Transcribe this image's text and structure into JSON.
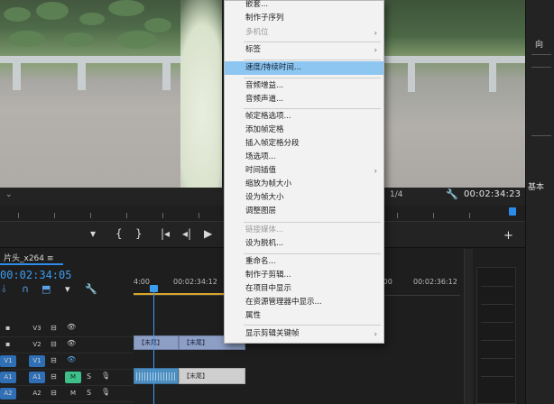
{
  "monitor": {
    "timecode": "00:02:34:23",
    "zoom": "1/4",
    "dropdown_icon": "chevron-down-icon"
  },
  "right_panel": {
    "label_top": "向",
    "label_mid": "基本"
  },
  "timeline": {
    "sequence_name": "片头_x264",
    "sequence_tc": "00:02:34:05",
    "ruler": [
      "4:00",
      "00:02:34:12",
      "00:02:35:00",
      "00:02:36:12"
    ],
    "tracks": [
      {
        "src": "",
        "name": "V3"
      },
      {
        "src": "",
        "name": "V2"
      },
      {
        "src": "V1",
        "name": "V1"
      },
      {
        "src": "A1",
        "name": "A1"
      },
      {
        "src": "A2",
        "name": "A2"
      }
    ],
    "track_buttons": {
      "mute": "M",
      "solo": "S"
    },
    "clips": {
      "v1a": "【末尾】",
      "v1b": "【末尾】",
      "a1b": "【末尾】"
    }
  },
  "context_menu": {
    "items": [
      {
        "label": "嵌套...",
        "enabled": true,
        "highlight": false,
        "submenu": false
      },
      {
        "label": "制作子序列",
        "enabled": true,
        "highlight": false,
        "submenu": false
      },
      {
        "label": "多机位",
        "enabled": false,
        "highlight": false,
        "submenu": true
      },
      {
        "label": "标签",
        "enabled": true,
        "highlight": false,
        "submenu": true
      },
      {
        "label": "速度/持续时间...",
        "enabled": true,
        "highlight": true,
        "submenu": false
      },
      {
        "label": "音频增益...",
        "enabled": true,
        "highlight": false,
        "submenu": false
      },
      {
        "label": "音频声道...",
        "enabled": true,
        "highlight": false,
        "submenu": false
      },
      {
        "label": "帧定格选项...",
        "enabled": true,
        "highlight": false,
        "submenu": false
      },
      {
        "label": "添加帧定格",
        "enabled": true,
        "highlight": false,
        "submenu": false
      },
      {
        "label": "插入帧定格分段",
        "enabled": true,
        "highlight": false,
        "submenu": false
      },
      {
        "label": "场选项...",
        "enabled": true,
        "highlight": false,
        "submenu": false
      },
      {
        "label": "时间插值",
        "enabled": true,
        "highlight": false,
        "submenu": true
      },
      {
        "label": "缩放为帧大小",
        "enabled": true,
        "highlight": false,
        "submenu": false
      },
      {
        "label": "设为帧大小",
        "enabled": true,
        "highlight": false,
        "submenu": false
      },
      {
        "label": "调整图层",
        "enabled": true,
        "highlight": false,
        "submenu": false
      },
      {
        "label": "链接媒体...",
        "enabled": false,
        "highlight": false,
        "submenu": false
      },
      {
        "label": "设为脱机...",
        "enabled": true,
        "highlight": false,
        "submenu": false
      },
      {
        "label": "重命名...",
        "enabled": true,
        "highlight": false,
        "submenu": false
      },
      {
        "label": "制作子剪辑...",
        "enabled": true,
        "highlight": false,
        "submenu": false
      },
      {
        "label": "在项目中显示",
        "enabled": true,
        "highlight": false,
        "submenu": false
      },
      {
        "label": "在资源管理器中显示...",
        "enabled": true,
        "highlight": false,
        "submenu": false
      },
      {
        "label": "属性",
        "enabled": true,
        "highlight": false,
        "submenu": false
      },
      {
        "label": "显示剪辑关键帧",
        "enabled": true,
        "highlight": false,
        "submenu": true
      }
    ]
  }
}
